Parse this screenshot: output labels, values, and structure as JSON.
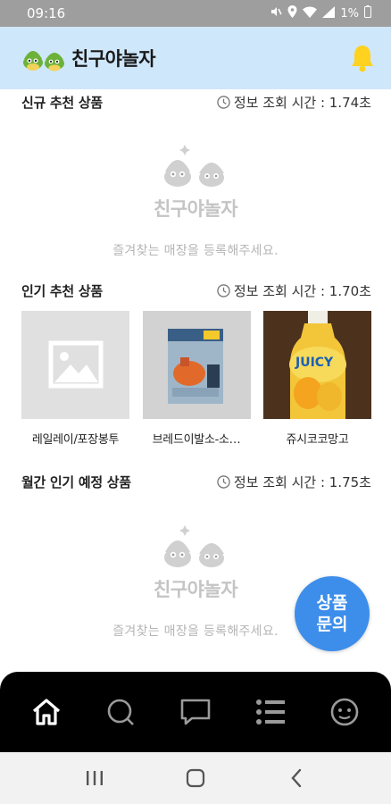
{
  "status_bar": {
    "time": "09:16",
    "battery": "1%"
  },
  "header": {
    "title": "친구야놀자"
  },
  "sections": [
    {
      "title": "신규 추천 상품",
      "query_time": "정보 조회 시간 : 1.74초",
      "empty": {
        "logo_text": "친구야놀자",
        "message": "즐겨찾는 매장을 등록해주세요."
      }
    },
    {
      "title": "인기 추천 상품",
      "query_time": "정보 조회 시간 : 1.70초",
      "products": [
        {
          "name": "레일레이/포장봉투",
          "image": "placeholder-image-icon"
        },
        {
          "name": "브레드이발소-소…",
          "image": "toy-box-photo"
        },
        {
          "name": "쥬시코코망고",
          "image": "juice-bottle-photo"
        }
      ]
    },
    {
      "title": "월간 인기 예정 상품",
      "query_time": "정보 조회 시간 : 1.75초",
      "empty": {
        "logo_text": "친구야놀자",
        "message": "즐겨찾는 매장을 등록해주세요."
      }
    }
  ],
  "fab": {
    "line1": "상품",
    "line2": "문의"
  },
  "bottom_nav": [
    "home-icon",
    "search-icon",
    "chat-icon",
    "list-icon",
    "my-face-icon"
  ],
  "colors": {
    "header_bg": "#cfe7fb",
    "accent": "#3d8eea",
    "bell": "#ffd21f",
    "nav_bg": "#000000",
    "mascot": "#6cb23a"
  }
}
